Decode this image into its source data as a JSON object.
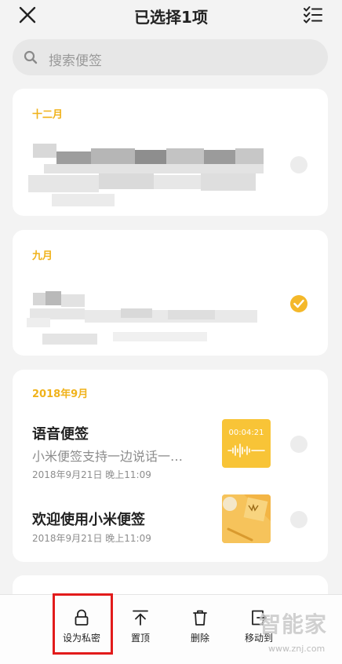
{
  "header": {
    "close_icon": "close-icon",
    "title": "已选择1项",
    "select_all_icon": "checklist-icon"
  },
  "search": {
    "placeholder": "搜索便签",
    "icon": "search-icon"
  },
  "groups": [
    {
      "month": "十二月",
      "notes": [
        {
          "content": "blurred",
          "selected": false
        }
      ]
    },
    {
      "month": "九月",
      "notes": [
        {
          "content": "blurred",
          "selected": true
        }
      ]
    },
    {
      "month": "2018年9月",
      "notes": [
        {
          "title": "语音便签",
          "preview": "小米便签支持一边说话一…",
          "time": "2018年9月21日 晚上11:09",
          "thumb_text": "00:04:21",
          "selected": false
        },
        {
          "title": "欢迎使用小米便签",
          "time": "2018年9月21日 晚上11:09",
          "selected": false
        }
      ]
    }
  ],
  "toolbar": {
    "actions": [
      {
        "label": "设为私密",
        "icon": "lock-icon"
      },
      {
        "label": "置顶",
        "icon": "pin-top-icon"
      },
      {
        "label": "删除",
        "icon": "trash-icon"
      },
      {
        "label": "移动到",
        "icon": "move-to-icon"
      }
    ]
  },
  "watermark": {
    "text": "智能家",
    "url": "www.znj.com"
  },
  "colors": {
    "accent": "#f4b82a",
    "highlight": "#e21b1b",
    "background": "#f3f3f3"
  }
}
